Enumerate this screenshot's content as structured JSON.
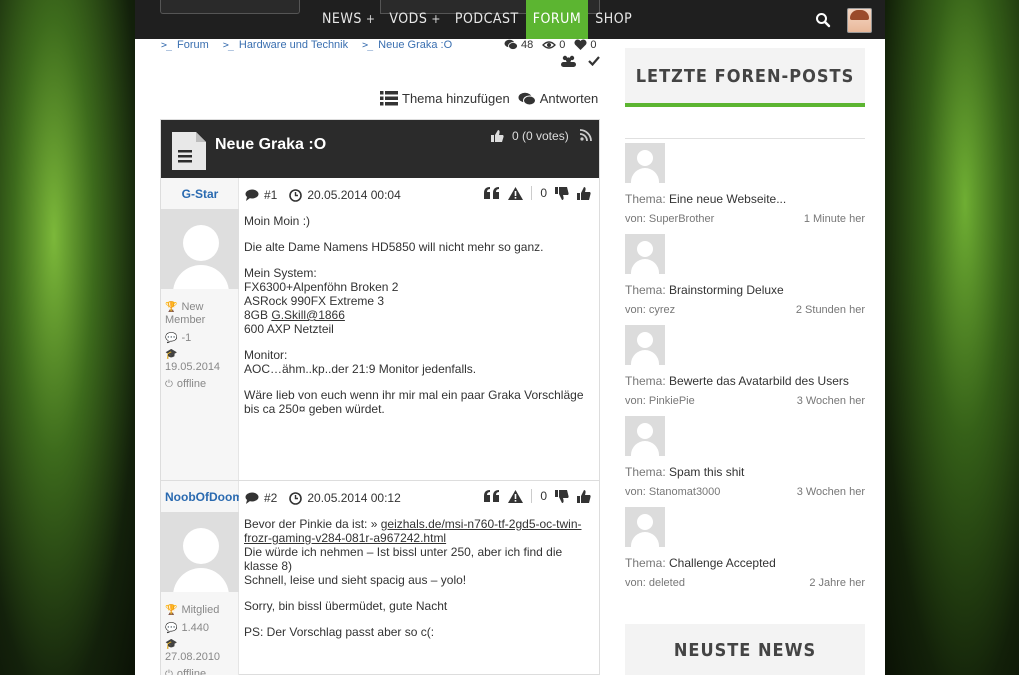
{
  "nav": {
    "items": [
      {
        "label": "NEWS",
        "plus": "+",
        "active": false
      },
      {
        "label": "VODS",
        "plus": "+",
        "active": false
      },
      {
        "label": "PODCAST",
        "plus": "",
        "active": false
      },
      {
        "label": "FORUM",
        "plus": "",
        "active": true
      },
      {
        "label": "SHOP",
        "plus": "",
        "active": false
      }
    ],
    "accent": "#5cb531"
  },
  "breadcrumb": [
    {
      "label": "Forum"
    },
    {
      "label": "Hardware und Technik"
    },
    {
      "label": "Neue Graka :O"
    }
  ],
  "stats": {
    "replies": "48",
    "views": "0",
    "likes": "0"
  },
  "actions": {
    "add_topic": "Thema hinzufügen",
    "reply": "Antworten"
  },
  "thread": {
    "title": "Neue Graka :O",
    "votes": "0 (0 votes)"
  },
  "posts": [
    {
      "user": "G-Star",
      "rank": "New Member",
      "posts": "-1",
      "joined": "19.05.2014",
      "status": "offline",
      "number": "#1",
      "date": "20.05.2014 00:04",
      "score": "0",
      "body": {
        "l1": "Moin Moin :)",
        "l2": "Die alte Dame Namens HD5850 will nicht mehr so ganz.",
        "l3": "Mein System:",
        "l4": "FX6300+Alpenföhn Broken 2",
        "l5": "ASRock 990FX Extreme 3",
        "l6a": "8GB ",
        "l6b": "G.Skill@1866",
        "l7": "600 AXP Netzteil",
        "l8": "Monitor:",
        "l9": "AOC…ähm..kp..der 21:9 Monitor jedenfalls.",
        "l10": "Wäre lieb von euch wenn ihr mir mal ein paar Graka Vorschläge bis ca 250¤ geben würdet."
      }
    },
    {
      "user": "NoobOfDoom",
      "rank": "Mitglied",
      "posts": "1.440",
      "joined": "27.08.2010",
      "status": "offline",
      "number": "#2",
      "date": "20.05.2014 00:12",
      "score": "0",
      "body": {
        "l1a": "Bevor der Pinkie da ist: » ",
        "l1b": "geizhals.de/msi-n760-tf-2gd5-oc-twin-frozr-gaming-v284-081r-a967242.html",
        "l2": "Die würde ich nehmen – Ist bissl unter 250, aber ich find die klasse 8)",
        "l3": "Schnell, leise und sieht spacig aus – yolo!",
        "l4": "Sorry, bin bissl übermüdet, gute Nacht",
        "l5": "PS: Der Vorschlag passt aber so c(:"
      }
    }
  ],
  "sidebar": {
    "forum_title": "LETZTE FOREN-POSTS",
    "thema_label": "Thema: ",
    "by_label": "von: ",
    "posts": [
      {
        "title": "Eine neue Webseite...",
        "author": "SuperBrother",
        "time": "1 Minute her"
      },
      {
        "title": "Brainstorming Deluxe",
        "author": "cyrez",
        "time": "2 Stunden her"
      },
      {
        "title": "Bewerte das Avatarbild des Users",
        "author": "PinkiePie",
        "time": "3 Wochen her"
      },
      {
        "title": "Spam this shit",
        "author": "Stanomat3000",
        "time": "3 Wochen her"
      },
      {
        "title": "Challenge Accepted",
        "author": "deleted",
        "time": "2 Jahre her"
      }
    ],
    "news_title": "NEUSTE NEWS"
  }
}
